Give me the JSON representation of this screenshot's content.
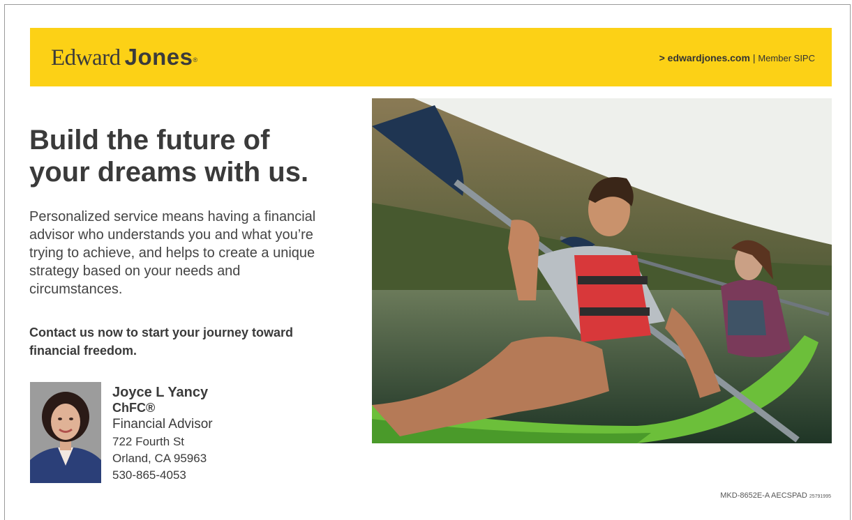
{
  "banner": {
    "logo_part1": "Edward",
    "logo_part2": "Jones",
    "logo_mark": "®",
    "url": "> edwardjones.com",
    "separator": "|",
    "member": "Member SIPC",
    "color": "#fcd116"
  },
  "headline": [
    "Build the future of",
    "your dreams with us."
  ],
  "body_text": "Personalized service means having a financial advisor who understands you and what you’re trying to achieve, and helps to create a unique strategy based on your needs and circumstances.",
  "cta": "Contact us now to start your journey toward financial freedom.",
  "advisor": {
    "name": "Joyce L Yancy",
    "credential": "ChFC®",
    "title": "Financial Advisor",
    "street": "722 Fourth St",
    "city": "Orland, CA 95963",
    "phone": "530-865-4053"
  },
  "footer": {
    "code": "MKD-8652E-A AECSPAD",
    "code_small": "25791995"
  }
}
